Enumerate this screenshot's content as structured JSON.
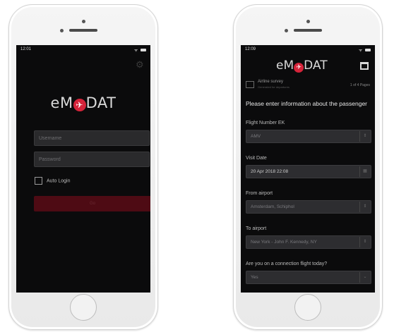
{
  "left_phone": {
    "status_time": "12:01",
    "logo": {
      "prefix": "eM",
      "badge": "✈",
      "suffix": "DAT"
    },
    "username_placeholder": "Username",
    "password_placeholder": "Password",
    "auto_login_label": "Auto Login",
    "login_button_label": "Go"
  },
  "right_phone": {
    "status_time": "12:09",
    "logo": {
      "prefix": "eM",
      "badge": "✈",
      "suffix": "DAT"
    },
    "survey_title": "Airline survey",
    "survey_subtitle": "Generated for departures",
    "survey_pages": "1 of 4 Pages",
    "intro": "Please enter information about the passenger",
    "questions": [
      {
        "label": "Flight Number EK",
        "value": "AMV"
      },
      {
        "label": "Visit Date",
        "value": "20 Apr 2018 22:08"
      },
      {
        "label": "From airport",
        "value": "Amsterdam, Schiphol"
      },
      {
        "label": "To airport",
        "value": "New York - John F. Kennedy, NY"
      },
      {
        "label": "Are you on a connection flight today?",
        "value": "Yes"
      }
    ]
  },
  "colors": {
    "brand_red": "#d6243a",
    "screen_bg": "#0b0b0c",
    "button_dark_red": "#4e0b14"
  },
  "icons": [
    "gear-icon",
    "calendar-icon",
    "survey-icon",
    "chevron-icon",
    "battery-icon",
    "wifi-icon"
  ]
}
